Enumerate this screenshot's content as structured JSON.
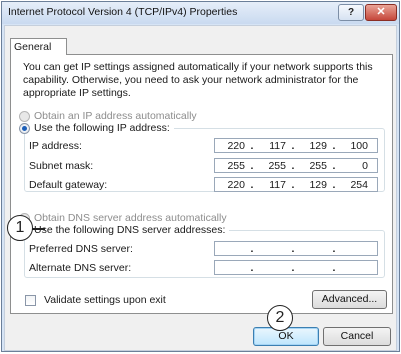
{
  "window": {
    "title": "Internet Protocol Version 4 (TCP/IPv4) Properties",
    "help_glyph": "?",
    "close_glyph": "✕"
  },
  "tabs": [
    {
      "label": "General"
    }
  ],
  "description": "You can get IP settings assigned automatically if your network supports this capability. Otherwise, you need to ask your network administrator for the appropriate IP settings.",
  "ip": {
    "auto_label": "Obtain an IP address automatically",
    "auto_checked": false,
    "manual_label": "Use the following IP address:",
    "manual_checked": true,
    "fields": [
      {
        "label": "IP address:",
        "octets": [
          "220",
          "117",
          "129",
          "100"
        ]
      },
      {
        "label": "Subnet mask:",
        "octets": [
          "255",
          "255",
          "255",
          "0"
        ]
      },
      {
        "label": "Default gateway:",
        "octets": [
          "220",
          "117",
          "129",
          "254"
        ]
      }
    ]
  },
  "dns": {
    "auto_label": "Obtain DNS server address automatically",
    "auto_checked": false,
    "manual_label": "Use the following DNS server addresses:",
    "manual_checked": true,
    "fields": [
      {
        "label": "Preferred DNS server:",
        "octets": [
          "",
          "",
          "",
          ""
        ]
      },
      {
        "label": "Alternate DNS server:",
        "octets": [
          "",
          "",
          "",
          ""
        ]
      }
    ]
  },
  "validate": {
    "label": "Validate settings upon exit",
    "checked": false
  },
  "buttons": {
    "advanced": "Advanced...",
    "ok": "OK",
    "cancel": "Cancel"
  },
  "callouts": {
    "one": "1",
    "two": "2"
  }
}
